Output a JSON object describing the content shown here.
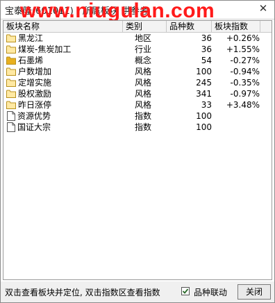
{
  "window": {
    "title": "宝泰隆(601011) - 所属板块 供参考",
    "watermark": "www.niugulan.com",
    "close_glyph": "✕"
  },
  "table": {
    "headers": [
      "板块名称",
      "类别",
      "品种数",
      "板块指数"
    ],
    "rows": [
      {
        "icon": "folder-icon",
        "name": "黑龙江",
        "type": "地区",
        "count": "36",
        "index": "+0.26%"
      },
      {
        "icon": "folder-icon",
        "name": "煤炭-焦炭加工",
        "type": "行业",
        "count": "36",
        "index": "+1.55%"
      },
      {
        "icon": "folder-filled-icon",
        "name": "石墨烯",
        "type": "概念",
        "count": "54",
        "index": "-0.27%"
      },
      {
        "icon": "folder-icon",
        "name": "户数增加",
        "type": "风格",
        "count": "100",
        "index": "-0.94%"
      },
      {
        "icon": "folder-icon",
        "name": "定增实施",
        "type": "风格",
        "count": "245",
        "index": "-0.35%"
      },
      {
        "icon": "folder-icon",
        "name": "股权激励",
        "type": "风格",
        "count": "341",
        "index": "-0.97%"
      },
      {
        "icon": "folder-icon",
        "name": "昨日涨停",
        "type": "风格",
        "count": "33",
        "index": "+3.48%"
      },
      {
        "icon": "document-icon",
        "name": "资源优势",
        "type": "指数",
        "count": "100",
        "index": ""
      },
      {
        "icon": "document-icon",
        "name": "国证大宗",
        "type": "指数",
        "count": "100",
        "index": ""
      }
    ]
  },
  "status": {
    "hint": "双击查看板块并定位, 双击指数区查看指数",
    "checkbox_label": "品种联动",
    "checkbox_checked": true,
    "close_button": "关闭"
  },
  "colors": {
    "watermark": "#ff1a1a",
    "folder": "#f5d26b"
  }
}
